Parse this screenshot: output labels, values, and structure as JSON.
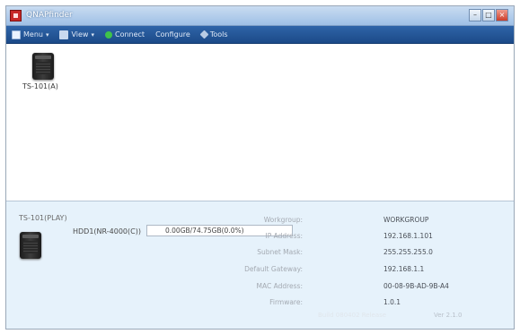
{
  "window": {
    "title": "QNAPfinder",
    "buttons": [
      "–",
      "□",
      "×"
    ]
  },
  "toolbar": {
    "items": [
      {
        "label": "Menu",
        "icon": "document-icon",
        "caret": "▾"
      },
      {
        "label": "View",
        "icon": "list-icon",
        "caret": "▾"
      },
      {
        "label": "Connect",
        "icon": "power-on-icon",
        "caret": ""
      },
      {
        "label": "Configure",
        "icon": "settings-icon",
        "caret": ""
      },
      {
        "label": "Tools",
        "icon": "wrench-icon",
        "caret": ""
      }
    ]
  },
  "devices": [
    {
      "name": "TS-101(A)",
      "icon": "nas-server-icon"
    }
  ],
  "details": {
    "device_name": "TS-101(PLAY)",
    "hdd_label": "HDD1(NR-4000(C))",
    "hdd_value": "0.00GB/74.75GB(0.0%)",
    "info": [
      {
        "label": "Workgroup:",
        "value": "WORKGROUP"
      },
      {
        "label": "IP Address:",
        "value": "192.168.1.101"
      },
      {
        "label": "Subnet Mask:",
        "value": "255.255.255.0"
      },
      {
        "label": "Default Gateway:",
        "value": "192.168.1.1"
      },
      {
        "label": "MAC Address:",
        "value": "00-08-9B-AD-9B-A4"
      },
      {
        "label": "Firmware:",
        "value": "1.0.1"
      }
    ],
    "footer_left": "Build 080402 Release",
    "footer_right": "Ver 2.1.0"
  },
  "colors": {
    "titlebar": "#9fc0e6",
    "toolbar": "#1b4a88",
    "details_bg": "#e6f2fb"
  }
}
